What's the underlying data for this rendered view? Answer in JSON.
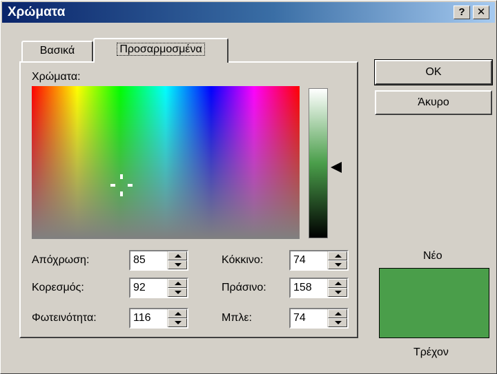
{
  "window": {
    "title": "Χρώματα",
    "help_label": "?",
    "close_label": "✕"
  },
  "tabs": [
    {
      "label": "Βασικά",
      "active": false
    },
    {
      "label": "Προσαρμοσμένα",
      "active": true
    }
  ],
  "colors_label": "Χρώματα:",
  "fields": {
    "hue": {
      "label": "Απόχρωση:",
      "value": "85"
    },
    "saturation": {
      "label": "Κορεσμός:",
      "value": "92"
    },
    "luminance": {
      "label": "Φωτεινότητα:",
      "value": "116"
    },
    "red": {
      "label": "Κόκκινο:",
      "value": "74"
    },
    "green": {
      "label": "Πράσινο:",
      "value": "158"
    },
    "blue": {
      "label": "Μπλε:",
      "value": "74"
    }
  },
  "buttons": {
    "ok": "OK",
    "cancel": "Άκυρο"
  },
  "preview": {
    "new_label": "Νέο",
    "current_label": "Τρέχον",
    "new_color": "#4a9e4a",
    "current_color": "#4a9e4a"
  }
}
